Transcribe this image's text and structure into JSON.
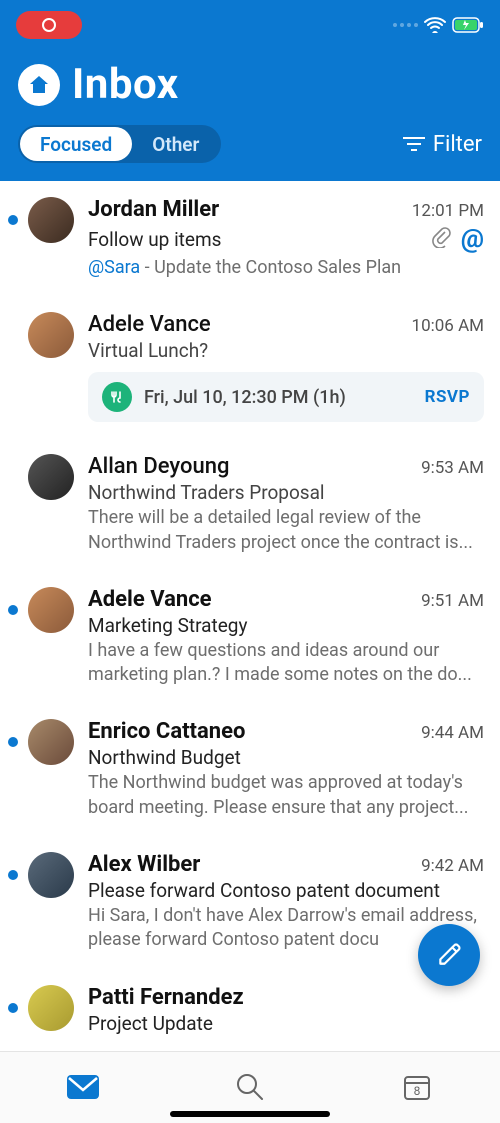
{
  "header": {
    "title": "Inbox",
    "tab_focused": "Focused",
    "tab_other": "Other",
    "filter_label": "Filter"
  },
  "bottom_calendar_day": "8",
  "emails": [
    {
      "sender": "Jordan Miller",
      "time": "12:01 PM",
      "subject": "Follow up items",
      "preview_mention": "@Sara",
      "preview_rest": " - Update the Contoso Sales Plan",
      "unread": true,
      "has_attachment": true,
      "has_mention": true,
      "avatar_class": "av-a"
    },
    {
      "sender": "Adele Vance",
      "time": "10:06 AM",
      "subject": "Virtual Lunch?",
      "unread": false,
      "avatar_class": "av-b",
      "rsvp": {
        "text": "Fri, Jul 10, 12:30 PM (1h)",
        "action": "RSVP"
      }
    },
    {
      "sender": "Allan Deyoung",
      "time": "9:53 AM",
      "subject": "Northwind Traders Proposal",
      "preview_rest": "There will be a detailed legal review of the Northwind Traders project once the contract is...",
      "unread": false,
      "avatar_class": "av-c"
    },
    {
      "sender": "Adele Vance",
      "time": "9:51 AM",
      "subject": "Marketing Strategy",
      "preview_rest": "I have a few questions and ideas around our marketing plan.? I made some notes on the do...",
      "unread": true,
      "avatar_class": "av-b"
    },
    {
      "sender": "Enrico Cattaneo",
      "time": "9:44 AM",
      "subject": "Northwind Budget",
      "preview_rest": "The Northwind budget was approved at today's board meeting. Please ensure that any project...",
      "unread": true,
      "avatar_class": "av-d"
    },
    {
      "sender": "Alex Wilber",
      "time": "9:42 AM",
      "subject": "Please forward Contoso patent document",
      "preview_rest": "Hi Sara, I don't have Alex Darrow's email address, please forward Contoso patent docu",
      "unread": true,
      "avatar_class": "av-e"
    },
    {
      "sender": "Patti Fernandez",
      "time": "",
      "subject": "Project Update",
      "unread": true,
      "avatar_class": "av-f"
    }
  ]
}
